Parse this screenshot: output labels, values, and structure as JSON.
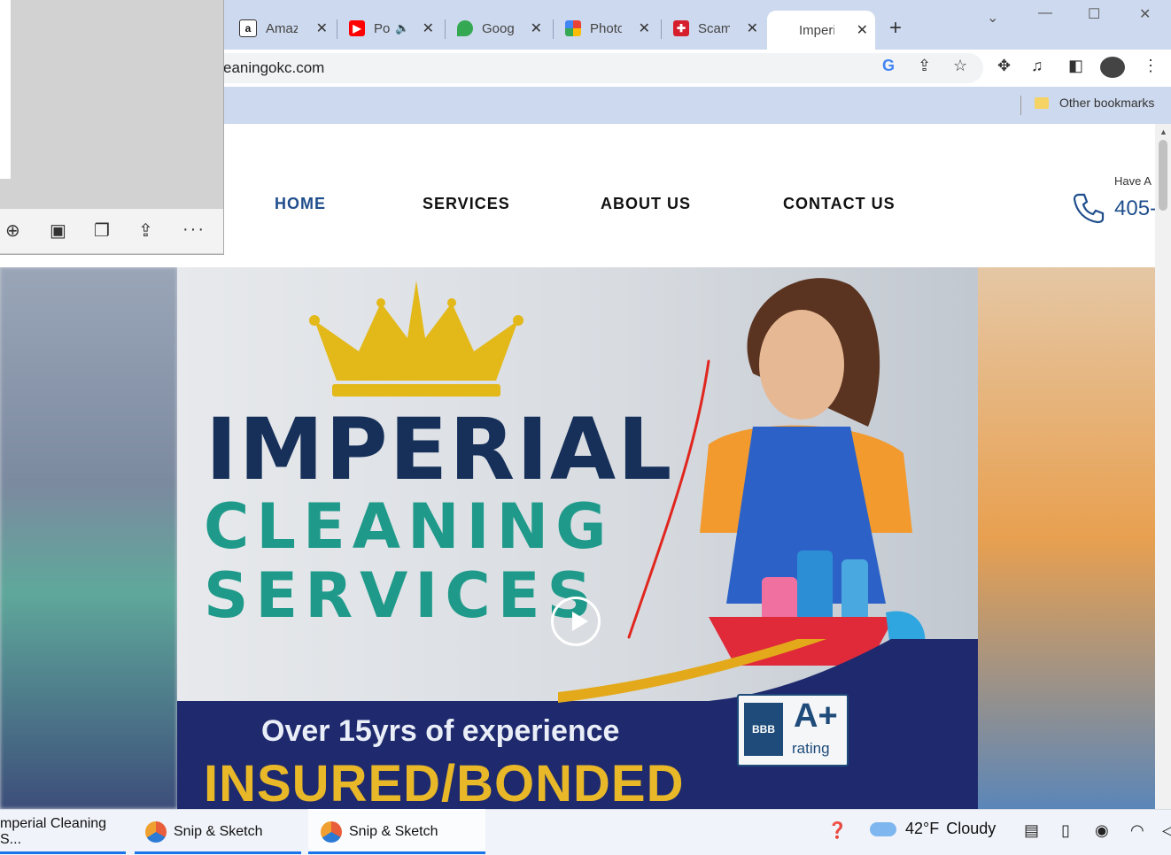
{
  "browser": {
    "tabs": [
      {
        "title": "Amazon",
        "favicon": "amazon-icon",
        "color": "#222222"
      },
      {
        "title": "Podcast",
        "favicon": "youtube-icon",
        "color": "#ff0000",
        "audio": true
      },
      {
        "title": "Google Maps",
        "favicon": "maps-icon",
        "color": "#34a853"
      },
      {
        "title": "Photos",
        "favicon": "photos-icon",
        "color": "#fbbc04"
      },
      {
        "title": "Scams",
        "favicon": "scam-site-icon",
        "color": "#d61f2c"
      },
      {
        "title": "Imperial Cleaning Services",
        "favicon": "site-icon",
        "color": "#ffffff",
        "active": true
      }
    ],
    "url": "eaningokc.com",
    "bookmarks": {
      "other_label": "Other bookmarks"
    }
  },
  "site": {
    "nav": [
      {
        "label": "HOME",
        "active": true
      },
      {
        "label": "SERVICES"
      },
      {
        "label": "ABOUT US"
      },
      {
        "label": "CONTACT US"
      }
    ],
    "header_right": {
      "have_a": "Have A",
      "phone": "405-"
    },
    "hero": {
      "line1": "IMPERIAL",
      "line2": "CLEANING",
      "line3": "SERVICES",
      "experience": "Over 15yrs of experience",
      "insured": "INSURED/BONDED",
      "bbb_logo": "BBB",
      "bbb_grade": "A+",
      "bbb_rating": "rating"
    }
  },
  "taskbar": {
    "items": [
      {
        "label": "mperial Cleaning S..."
      },
      {
        "label": "Snip & Sketch"
      },
      {
        "label": "Snip & Sketch"
      }
    ],
    "weather": {
      "temp": "42°F",
      "condition": "Cloudy"
    }
  }
}
